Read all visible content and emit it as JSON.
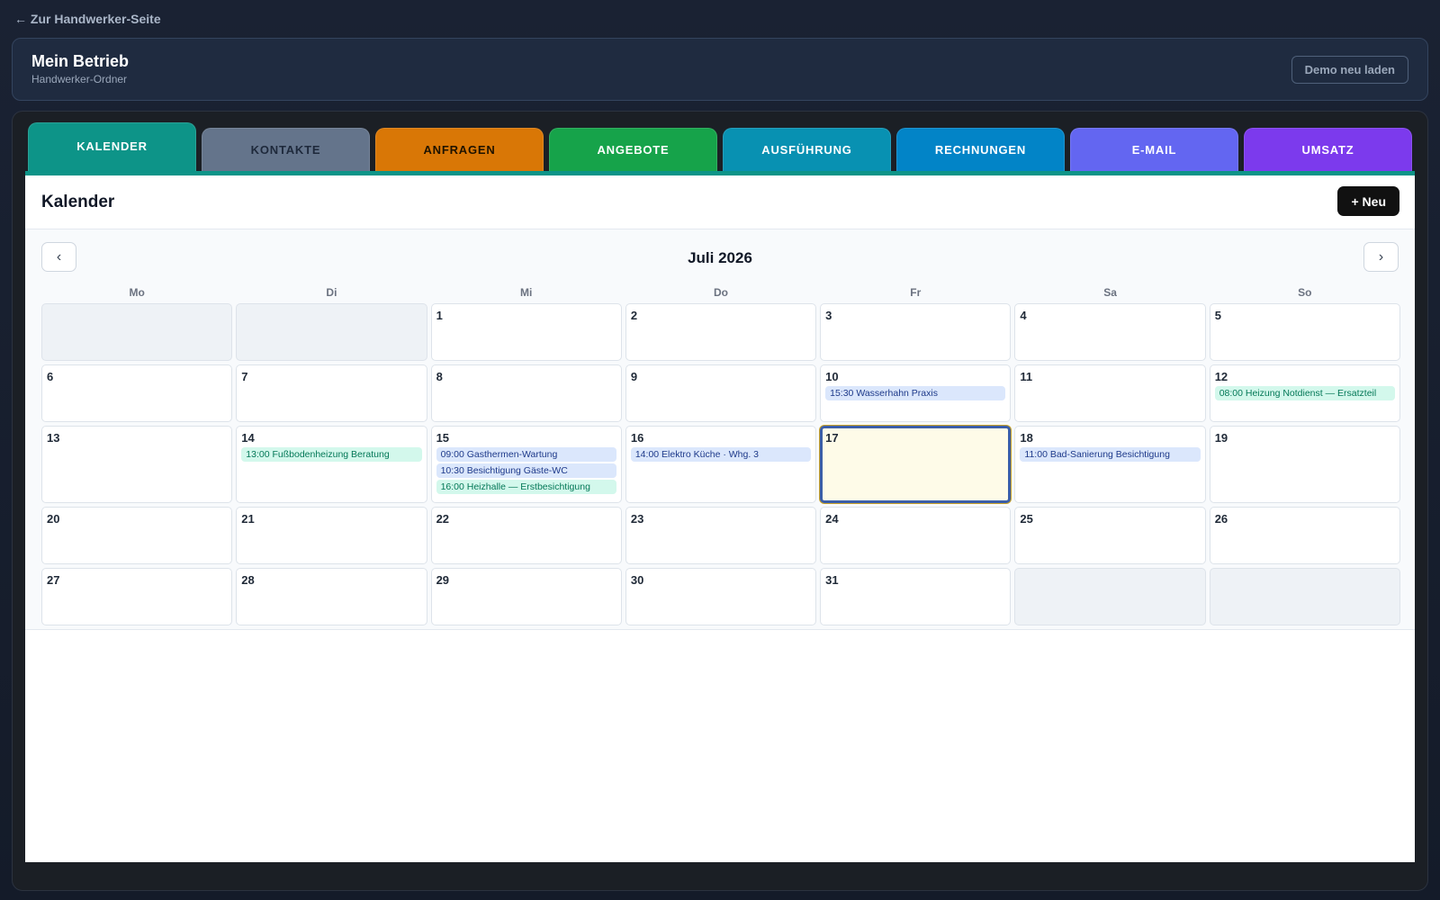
{
  "nav": {
    "back_label": "← Zur Handwerker-Seite"
  },
  "header": {
    "title": "Mein Betrieb",
    "subtitle": "Handwerker-Ordner",
    "demo_button": "Demo neu laden"
  },
  "tabs": [
    {
      "label": "KALENDER",
      "bg": "#0d9488",
      "color": "#ffffff",
      "active": true
    },
    {
      "label": "KONTAKTE",
      "bg": "#64748b",
      "color": "#1e293b",
      "active": false
    },
    {
      "label": "ANFRAGEN",
      "bg": "#d97706",
      "color": "#1f1300",
      "active": false
    },
    {
      "label": "ANGEBOTE",
      "bg": "#16a34a",
      "color": "#ffffff",
      "active": false
    },
    {
      "label": "AUSFÜHRUNG",
      "bg": "#0891b2",
      "color": "#ffffff",
      "active": false
    },
    {
      "label": "RECHNUNGEN",
      "bg": "#0284c7",
      "color": "#ffffff",
      "active": false
    },
    {
      "label": "E-MAIL",
      "bg": "#6366f1",
      "color": "#ffffff",
      "active": false
    },
    {
      "label": "UMSATZ",
      "bg": "#7c3aed",
      "color": "#ffffff",
      "active": false
    }
  ],
  "panel": {
    "title": "Kalender",
    "new_button": "+ Neu"
  },
  "calendar": {
    "prev_label": "‹",
    "next_label": "›",
    "month_label": "Juli 2026",
    "weekdays": [
      "Mo",
      "Di",
      "Mi",
      "Do",
      "Fr",
      "Sa",
      "So"
    ],
    "today": 17,
    "weeks": [
      [
        null,
        null,
        {
          "day": "1"
        },
        {
          "day": "2"
        },
        {
          "day": "3"
        },
        {
          "day": "4"
        },
        {
          "day": "5"
        }
      ],
      [
        {
          "day": "6"
        },
        {
          "day": "7"
        },
        {
          "day": "8"
        },
        {
          "day": "9"
        },
        {
          "day": "10",
          "events": [
            {
              "text": "15:30 Wasserhahn Praxis",
              "color": "blue"
            }
          ]
        },
        {
          "day": "11"
        },
        {
          "day": "12",
          "events": [
            {
              "text": "08:00 Heizung Notdienst — Ersatzteil",
              "color": "green"
            }
          ]
        }
      ],
      [
        {
          "day": "13"
        },
        {
          "day": "14",
          "events": [
            {
              "text": "13:00 Fußbodenheizung Beratung",
              "color": "green"
            }
          ]
        },
        {
          "day": "15",
          "events": [
            {
              "text": "09:00 Gasthermen-Wartung",
              "color": "blue"
            },
            {
              "text": "10:30 Besichtigung Gäste-WC",
              "color": "blue"
            },
            {
              "text": "16:00 Heizhalle — Erstbesichtigung",
              "color": "green"
            }
          ]
        },
        {
          "day": "16",
          "events": [
            {
              "text": "14:00 Elektro Küche · Whg. 3",
              "color": "blue"
            }
          ]
        },
        {
          "day": "17",
          "today": true
        },
        {
          "day": "18",
          "events": [
            {
              "text": "11:00 Bad-Sanierung Besichtigung",
              "color": "blue"
            }
          ]
        },
        {
          "day": "19"
        }
      ],
      [
        {
          "day": "20"
        },
        {
          "day": "21"
        },
        {
          "day": "22"
        },
        {
          "day": "23"
        },
        {
          "day": "24"
        },
        {
          "day": "25"
        },
        {
          "day": "26"
        }
      ],
      [
        {
          "day": "27"
        },
        {
          "day": "28"
        },
        {
          "day": "29"
        },
        {
          "day": "30"
        },
        {
          "day": "31"
        },
        null,
        null
      ]
    ]
  }
}
